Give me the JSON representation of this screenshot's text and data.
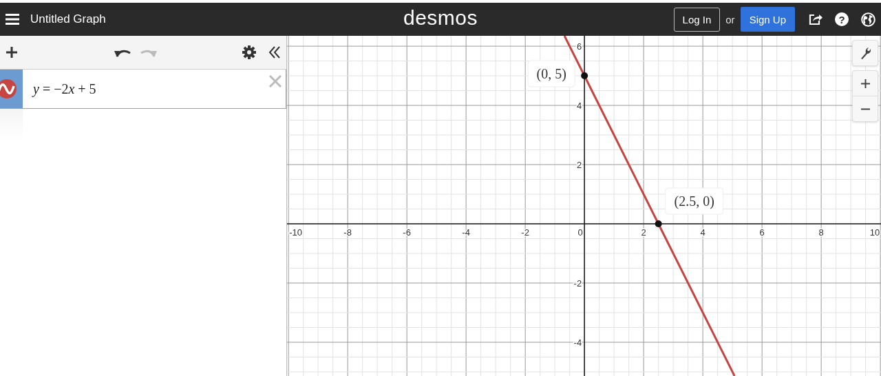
{
  "header": {
    "title": "Untitled Graph",
    "logo": "desmos",
    "login": "Log In",
    "or": "or",
    "signup": "Sign Up",
    "help": "?"
  },
  "toolbar": {
    "undo": {
      "disabled": false
    },
    "redo": {
      "disabled": true
    }
  },
  "expressions": [
    {
      "parts": [
        {
          "text": "y",
          "italic": true
        },
        {
          "text": " = −2",
          "italic": false
        },
        {
          "text": "x",
          "italic": true
        },
        {
          "text": " + 5",
          "italic": false
        }
      ],
      "color": "#c74440",
      "selected": true
    }
  ],
  "graph": {
    "chart_data": {
      "type": "line",
      "grid": true,
      "xlim": [
        -10.05,
        10.02
      ],
      "ylim": [
        -5.14,
        6.35
      ],
      "xticks": [
        -10,
        -8,
        -6,
        -4,
        -2,
        0,
        2,
        4,
        6,
        8,
        10
      ],
      "yticks": [
        -4,
        -2,
        2,
        4,
        6
      ],
      "x": [
        -0.675,
        0,
        2.5,
        5.07
      ],
      "series": [
        {
          "color": "#c74440",
          "values": [
            6.35,
            5,
            0,
            -5.14
          ]
        }
      ],
      "annotations": [
        {
          "x": 0,
          "y": 5,
          "text": "(0, 5)"
        },
        {
          "x": 2.5,
          "y": 0,
          "text": "(2.5, 0)"
        }
      ]
    }
  }
}
